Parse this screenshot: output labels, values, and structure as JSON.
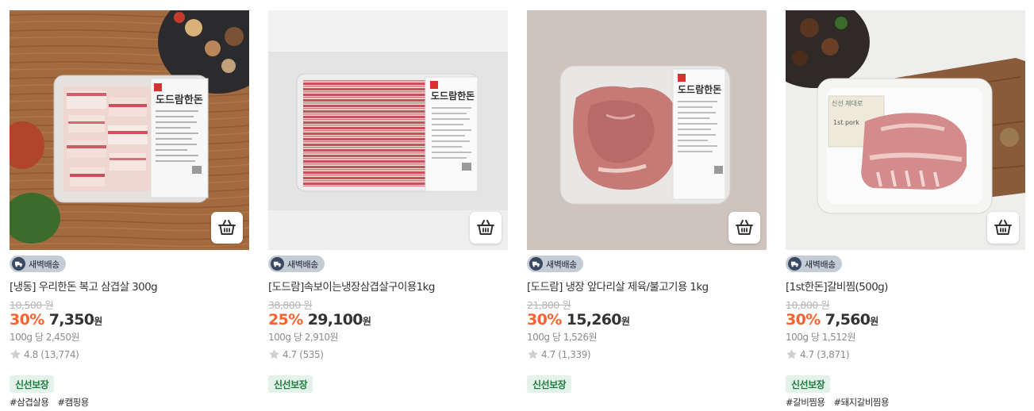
{
  "cart_icon": "basket-icon",
  "rating_icon": "star-icon",
  "delivery_icon": "truck-icon",
  "colors": {
    "discount": "#fa622f",
    "fresh_badge_bg": "#e4f3ea",
    "fresh_badge_text": "#1d7a3d",
    "delivery_badge_bg": "#c4ccd6"
  },
  "products": [
    {
      "delivery_label": "새벽배송",
      "label_brand": "도드람한돈",
      "title": "[냉동] 우리한돈 복고 삼겹살 300g",
      "original_price": "10,500 원",
      "discount": "30%",
      "sale_price": "7,350",
      "currency": "원",
      "unit_price": "100g 당 2,450원",
      "rating": "4.8 (13,774)",
      "badge": "신선보장",
      "tags": [
        "#삼겹살용",
        "#캠핑용"
      ]
    },
    {
      "delivery_label": "새벽배송",
      "label_brand": "도드람한돈",
      "title": "[도드람]속보이는냉장삼겹살구이용1kg",
      "original_price": "38,800 원",
      "discount": "25%",
      "sale_price": "29,100",
      "currency": "원",
      "unit_price": "100g 당 2,910원",
      "rating": "4.7 (535)",
      "badge": "신선보장",
      "tags": []
    },
    {
      "delivery_label": "새벽배송",
      "label_brand": "도드람한돈",
      "title": "[도드람] 냉장 앞다리살 제육/불고기용 1kg",
      "original_price": "21,800 원",
      "discount": "30%",
      "sale_price": "15,260",
      "currency": "원",
      "unit_price": "100g 당 1,526원",
      "rating": "4.7 (1,339)",
      "badge": "신선보장",
      "tags": []
    },
    {
      "delivery_label": "새벽배송",
      "label_brand": "1st pork",
      "title": "[1st한돈]갈비찜(500g)",
      "original_price": "10,800 원",
      "discount": "30%",
      "sale_price": "7,560",
      "currency": "원",
      "unit_price": "100g 당 1,512원",
      "rating": "4.7 (3,871)",
      "badge": "신선보장",
      "tags": [
        "#갈비찜용",
        "#돼지갈비찜용"
      ]
    }
  ]
}
